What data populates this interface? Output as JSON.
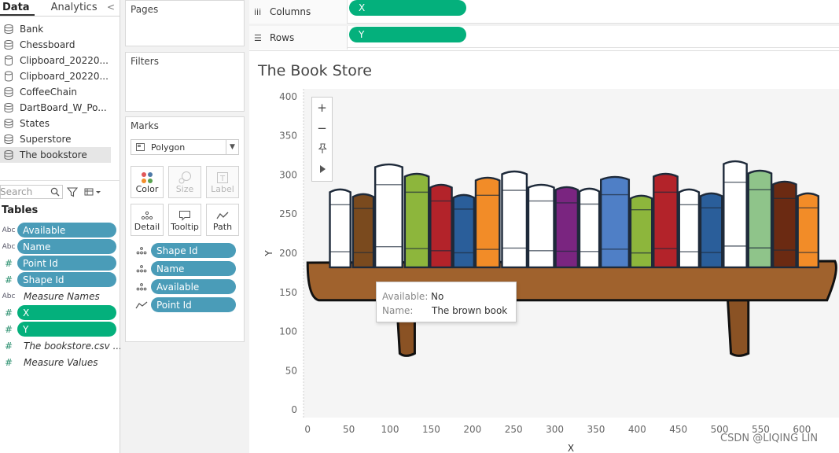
{
  "left_pane": {
    "tabs": {
      "data": "Data",
      "analytics": "Analytics",
      "collapse": "<"
    },
    "data_sources": [
      {
        "label": "Bank",
        "icon": "multi-table-icon",
        "selected": false
      },
      {
        "label": "Chessboard",
        "icon": "multi-table-icon",
        "selected": false
      },
      {
        "label": "Clipboard_20220...",
        "icon": "cylinder-icon",
        "selected": false
      },
      {
        "label": "Clipboard_20220...",
        "icon": "cylinder-icon",
        "selected": false
      },
      {
        "label": "CoffeeChain",
        "icon": "multi-table-icon",
        "selected": false
      },
      {
        "label": "DartBoard_W_Po...",
        "icon": "multi-table-icon",
        "selected": false
      },
      {
        "label": "States",
        "icon": "multi-table-icon",
        "selected": false
      },
      {
        "label": "Superstore",
        "icon": "multi-table-icon",
        "selected": false
      },
      {
        "label": "The bookstore",
        "icon": "multi-table-icon",
        "selected": true
      }
    ],
    "search_placeholder": "Search",
    "tables_heading": "Tables",
    "fields": [
      {
        "type": "Abc",
        "label": "Available",
        "style": "dimension"
      },
      {
        "type": "Abc",
        "label": "Name",
        "style": "dimension"
      },
      {
        "type": "#",
        "label": "Point Id",
        "style": "dimension"
      },
      {
        "type": "#",
        "label": "Shape Id",
        "style": "dimension"
      },
      {
        "type": "Abc",
        "label": "Measure Names",
        "style": "italic"
      },
      {
        "type": "#",
        "label": "X",
        "style": "measure"
      },
      {
        "type": "#",
        "label": "Y",
        "style": "measure"
      },
      {
        "type": "#",
        "label": "The bookstore.csv ...",
        "style": "italic"
      },
      {
        "type": "#",
        "label": "Measure Values",
        "style": "italic"
      }
    ]
  },
  "shelves": {
    "pages": "Pages",
    "filters": "Filters",
    "marks": {
      "title": "Marks",
      "mark_type": "Polygon",
      "buttons": [
        {
          "label": "Color",
          "enabled": true
        },
        {
          "label": "Size",
          "enabled": false
        },
        {
          "label": "Label",
          "enabled": false
        },
        {
          "label": "Detail",
          "enabled": true
        },
        {
          "label": "Tooltip",
          "enabled": true
        },
        {
          "label": "Path",
          "enabled": true
        }
      ],
      "cards": [
        {
          "icon": "detail-dots-icon",
          "label": "Shape Id"
        },
        {
          "icon": "detail-dots-icon",
          "label": "Name"
        },
        {
          "icon": "detail-dots-icon",
          "label": "Available"
        },
        {
          "icon": "path-line-icon",
          "label": "Point Id"
        }
      ]
    }
  },
  "columns_shelf": {
    "label": "Columns",
    "pill": "X"
  },
  "rows_shelf": {
    "label": "Rows",
    "pill": "Y"
  },
  "sheet": {
    "title": "The Book Store"
  },
  "tooltip": {
    "rows": [
      {
        "key": "Available:",
        "value": "No"
      },
      {
        "key": "Name:",
        "value": "The brown book"
      }
    ]
  },
  "watermark": "CSDN @LIQING LIN",
  "colors": {
    "dimension_pill": "#4a9cb8",
    "measure_pill": "#04b07c",
    "shelf_wood": "#a0622d",
    "plot_bg": "#f5f5f5"
  },
  "chart_data": {
    "type": "polygon",
    "xlabel": "X",
    "ylabel": "Y",
    "x_ticks": [
      0,
      50,
      100,
      150,
      200,
      250,
      300,
      350,
      400,
      450,
      500,
      550,
      600
    ],
    "y_ticks": [
      0,
      50,
      100,
      150,
      200,
      250,
      300,
      350,
      400
    ],
    "xlim": [
      -5,
      645
    ],
    "ylim": [
      -10,
      410
    ],
    "books": [
      {
        "x0": 27,
        "x1": 52,
        "top": 282,
        "color": "#ffffff"
      },
      {
        "x0": 55,
        "x1": 80,
        "top": 276,
        "color": "#7a4a1e"
      },
      {
        "x0": 82,
        "x1": 115,
        "top": 314,
        "color": "#ffffff"
      },
      {
        "x0": 118,
        "x1": 147,
        "top": 302,
        "color": "#8db63c"
      },
      {
        "x0": 149,
        "x1": 175,
        "top": 288,
        "color": "#b3232a"
      },
      {
        "x0": 177,
        "x1": 202,
        "top": 275,
        "color": "#2a5e9a"
      },
      {
        "x0": 204,
        "x1": 233,
        "top": 297,
        "color": "#f28c28"
      },
      {
        "x0": 236,
        "x1": 266,
        "top": 305,
        "color": "#ffffff"
      },
      {
        "x0": 268,
        "x1": 299,
        "top": 288,
        "color": "#ffffff"
      },
      {
        "x0": 301,
        "x1": 328,
        "top": 285,
        "color": "#7a2580"
      },
      {
        "x0": 330,
        "x1": 354,
        "top": 283,
        "color": "#ffffff"
      },
      {
        "x0": 356,
        "x1": 390,
        "top": 298,
        "color": "#4f7fc6"
      },
      {
        "x0": 392,
        "x1": 418,
        "top": 274,
        "color": "#8db63c"
      },
      {
        "x0": 420,
        "x1": 449,
        "top": 302,
        "color": "#b3232a"
      },
      {
        "x0": 451,
        "x1": 475,
        "top": 282,
        "color": "#ffffff"
      },
      {
        "x0": 477,
        "x1": 503,
        "top": 277,
        "color": "#2a5e9a"
      },
      {
        "x0": 505,
        "x1": 533,
        "top": 318,
        "color": "#ffffff"
      },
      {
        "x0": 535,
        "x1": 563,
        "top": 306,
        "color": "#8fc48a"
      },
      {
        "x0": 565,
        "x1": 593,
        "top": 292,
        "color": "#6b2a12"
      },
      {
        "x0": 595,
        "x1": 620,
        "top": 277,
        "color": "#f28c28"
      }
    ],
    "shelf": {
      "x0": 0,
      "x1": 640,
      "top": 188,
      "bottom": 140
    },
    "brackets": [
      {
        "x0": 108,
        "x1": 130,
        "bottom": 72
      },
      {
        "x0": 510,
        "x1": 535,
        "bottom": 72
      }
    ]
  }
}
